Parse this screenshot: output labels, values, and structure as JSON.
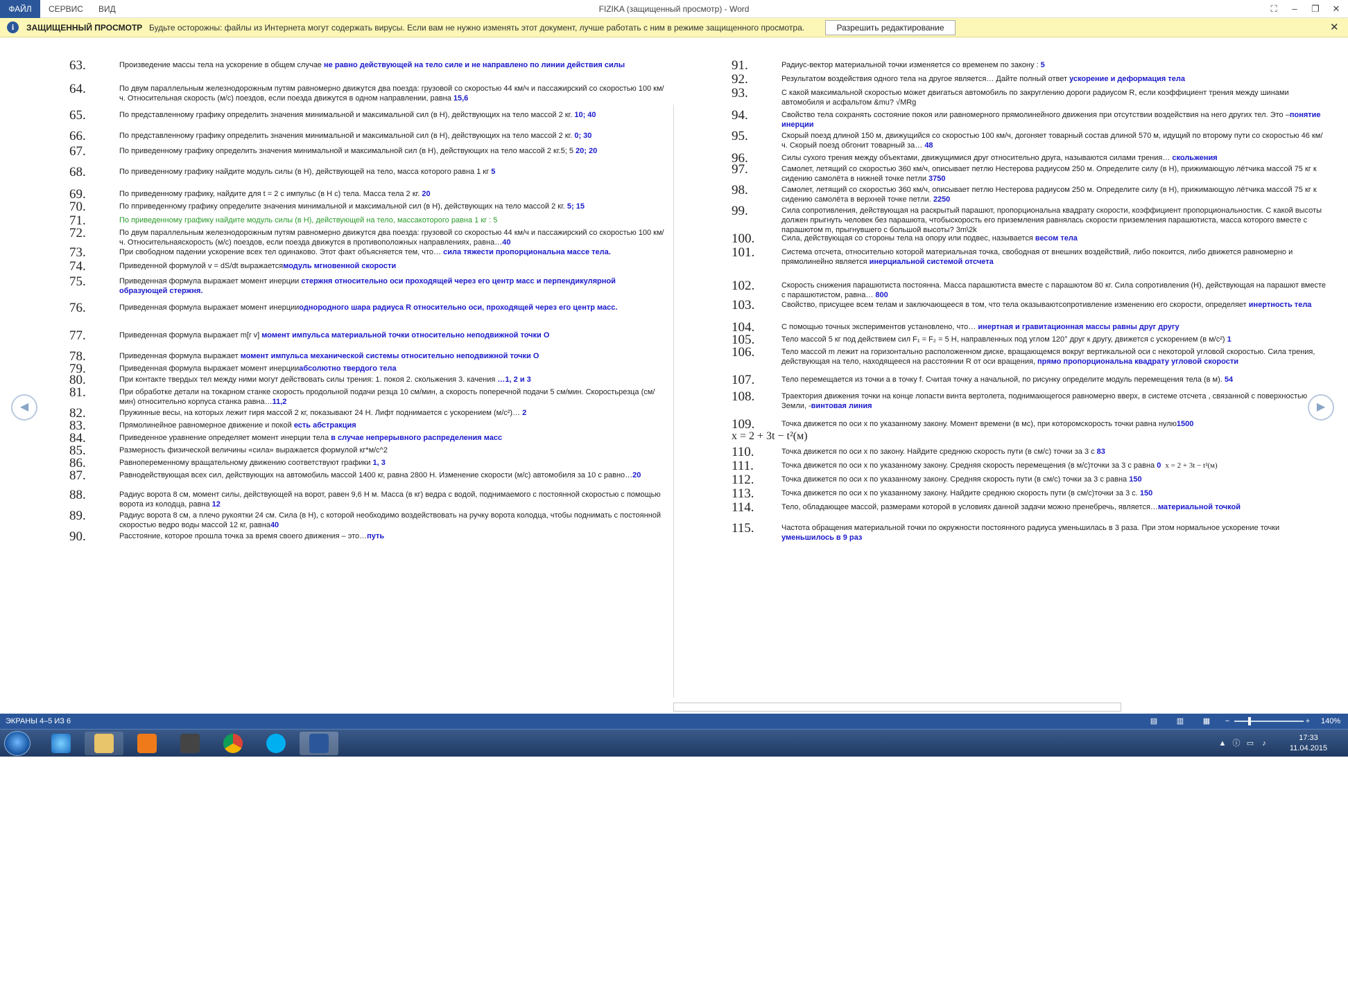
{
  "ribbon": {
    "file_tab": "ФАЙЛ",
    "tabs": [
      "СЕРВИС",
      "ВИД"
    ],
    "title": "FIZIKA (защищенный просмотр) - Word"
  },
  "protected_bar": {
    "title": "ЗАЩИЩЕННЫЙ ПРОСМОТР",
    "message": "Будьте осторожны: файлы из Интернета могут содержать вирусы. Если вам не нужно изменять этот документ, лучше работать с ним в режиме защищенного просмотра.",
    "button": "Разрешить редактирование"
  },
  "left_items": [
    {
      "n": "63.",
      "t": "Произведение массы тела на ускорение в общем случае ",
      "a": "не равно действующей на тело силе и не направлено по линии действия силы"
    },
    {
      "n": "64.",
      "t": "По двум параллельным железнодорожным путям равномерно движутся два поезда: грузовой со скоростью 44 км/ч и пассажирский со скоростью 100 км/ч. Относительная скорость (м/с) поездов, если поезда движутся в одном направлении, равна ",
      "a": "15,6"
    },
    {
      "n": "65.",
      "t": "По представленному графику определить значения минимальной и максимальной сил (в Н), действующих на тело массой 2 кг. ",
      "a": "10; 40"
    },
    {
      "n": "66.",
      "t": "По представленному графику определить значения минимальной и максимальной сил (в Н), действующих на тело массой 2 кг. ",
      "a": "0; 30"
    },
    {
      "n": "67.",
      "t": "По приведенному графику определить значения минимальной и максимальной сил (в Н), действующих на тело массой 2 кг.5; 5 ",
      "a": "20; 20"
    },
    {
      "n": "68.",
      "t": "По приведенному графику найдите модуль силы (в Н), действующей на тело, масса которого равна 1 кг ",
      "a": "5"
    },
    {
      "n": "69.",
      "t": "По приведенному графику, найдите для t = 2 с импульс (в Н с) тела. Масса тела 2 кг. ",
      "a": "20"
    },
    {
      "n": "70.",
      "t": "По пприведенному графику определите значения минимальной и максимальной сил (в Н), действующих на тело массой 2 кг. ",
      "a": "5; 15"
    },
    {
      "n": "71.",
      "t": "По приведенному графику найдите модуль силы (в Н), действующей на тело, массакоторого равна 1 кг : 5",
      "a": "",
      "green": true
    },
    {
      "n": "72.",
      "t": "По двум параллельным железнодорожным путям равномерно движутся два поезда: грузовой со скоростью 44 км/ч и пассажирский со скоростью 100 км/ч. Относительнаяскорость (м/с) поездов, если поезда движутся в противоположных направлениях, равна…",
      "a": "40"
    },
    {
      "n": "73.",
      "t": "При свободном падении ускорение всех тел одинаково. Этот факт объясняется тем, что… ",
      "a": "сила тяжести пропорциональна массе тела."
    },
    {
      "n": "74.",
      "t": "Приведенной формулой v = dS/dt выражается",
      "a": "модуль мгновенной скорости"
    },
    {
      "n": "75.",
      "t": "Приведенная формула выражает момент инерции ",
      "a": "стержня относительно оси проходящей через его центр масс и перпендикулярной образующей стержня."
    },
    {
      "n": "76.",
      "t": "Приведенная формула выражает момент инерции",
      "a": "однородного шара радиуса R относительно оси, проходящей через его центр масс."
    },
    {
      "n": "77.",
      "t": "Приведенная формула выражает m[r v] ",
      "a": "момент импульса материальной точки относительно неподвижной точки О"
    },
    {
      "n": "78.",
      "t": "Приведенная формула выражает ",
      "a": "момент импульса механической системы относительно неподвижной точки О"
    },
    {
      "n": "79.",
      "t": "Приведенная формула выражает момент инерции",
      "a": "абсолютно твердого тела"
    },
    {
      "n": "80.",
      "t": "При контакте твердых тел между ними могут действовать силы трения: 1. покоя 2. скольжения 3. качения ",
      "a": "…1, 2 и 3"
    },
    {
      "n": "81.",
      "t": "При обработке детали на токарном станке скорость продольной подачи резца 10 см/мин, а скорость поперечной подачи 5 см/мин. Скоростьрезца (см/мин) относительно корпуса станка равна…",
      "a": "11,2"
    },
    {
      "n": "82.",
      "t": "Пружинные весы, на которых лежит гиря массой 2 кг, показывают 24 Н. Лифт поднимается с ускорением (м/с²)… ",
      "a": "2"
    },
    {
      "n": "83.",
      "t": "Прямолинейное равномерное движение и покой ",
      "a": "есть абстракция"
    },
    {
      "n": "84.",
      "t": "Приведенное уравнение определяет момент инерции тела ",
      "a": "в случае непрерывного распределения масс"
    },
    {
      "n": "85.",
      "t": "Размерность физической величины «сила» выражается формулой кг*м/с^2",
      "a": ""
    },
    {
      "n": "86.",
      "t": "Равнопеременному вращательному движению соответствуют графики ",
      "a": "1, 3"
    },
    {
      "n": "87.",
      "t": "Равнодействующая всех сил, действующих на автомобиль массой 1400 кг, равна 2800 Н. Изменение скорости (м/с) автомобиля за 10 с равно…",
      "a": "20"
    },
    {
      "n": "88.",
      "t": "Радиус ворота 8 см, момент силы, действующей на ворот, равен 9,6 Н м. Масса (в кг) ведра с водой, поднимаемого с постоянной скоростью с помощью ворота из колодца, равна ",
      "a": "12"
    },
    {
      "n": "89.",
      "t": "Радиус ворота 8 см, а плечо рукоятки 24 см. Сила (в Н), с которой необходимо воздействовать на ручку ворота колодца, чтобы поднимать с постоянной скоростью ведро воды массой 12 кг, равна",
      "a": "40"
    },
    {
      "n": "90.",
      "t": "Расстояние, которое прошла точка за время своего движения – это…",
      "a": "путь"
    }
  ],
  "right_items": [
    {
      "n": "91.",
      "t": "Радиус-вектор материальной точки изменяется со временем по закону : ",
      "a": "5"
    },
    {
      "n": "92.",
      "t": "Результатом воздействия одного тела на другое является… Дайте полный ответ ",
      "a": "ускорение и деформация тела"
    },
    {
      "n": "93.",
      "t": "С какой максимальной скоростью может двигаться автомобиль по закруглению дороги радиусом R, если коэффициент трения между шинами автомобиля и асфальтом &mu? √MRg",
      "a": ""
    },
    {
      "n": "94.",
      "t": "Свойство тела сохранять состояние покоя или равномерного прямолинейного движения при отсутствии воздействия на него других тел. Это –",
      "a": "понятие инерции"
    },
    {
      "n": "95.",
      "t": "Скорый поезд длиной 150 м, движущийся со скоростью 100 км/ч, догоняет товарный состав длиной 570 м, идущий по второму пути со скоростью 46 км/ч. Скорый поезд обгонит товарный за… ",
      "a": "48"
    },
    {
      "n": "96.",
      "t": "Силы сухого трения между объектами, движущимися друг относительно друга, называются силами трения… ",
      "a": "скольжения"
    },
    {
      "n": "97.",
      "t": "Самолет, летящий со скоростью 360 км/ч, описывает петлю Нестерова радиусом 250 м. Определите силу (в Н), прижимающую лётчика массой 75 кг к сидению самолёта в нижней точке петли ",
      "a": "3750"
    },
    {
      "n": "98.",
      "t": "Самолет, летящий со скоростью 360 км/ч, описывает петлю Нестерова радиусом 250 м. Определите силу (в Н), прижимающую лётчика массой 75 кг к сидению самолёта в верхней точке петли. ",
      "a": "2250"
    },
    {
      "n": "99.",
      "t": "Сила сопротивления, действующая на раскрытый парашют, пропорциональна квадрату скорости, коэффициент пропорциональностик. С какой высоты должен прыгнуть человек без парашюта, чтобыскорость его приземления равнялась скорости приземления парашютиста, масса которого вместе с парашютом m, прыгнувшего с большой высоты? 3m\\2k",
      "a": ""
    },
    {
      "n": "100.",
      "t": "Сила, действующая со стороны тела на опору или подвес, называется ",
      "a": "весом тела"
    },
    {
      "n": "101.",
      "t": "Система отсчета, относительно которой материальная точка, свободная от внешних воздействий, либо покоится, либо движется равномерно и прямолинейно является ",
      "a": "инерциальной системой отсчета"
    },
    {
      "n": "102.",
      "t": "Скорость снижения парашютиста постоянна. Масса парашютиста вместе с парашютом 80 кг. Сила сопротивления (Н), действующая на парашют вместе с парашютистом, равна… ",
      "a": "800"
    },
    {
      "n": "103.",
      "t": "Свойство, присущее всем телам и заключающееся в том, что тела оказываютсопротивление изменению его скорости, определяет ",
      "a": "инертность тела"
    },
    {
      "n": "104.",
      "t": "С помощью точных экспериментов установлено, что… ",
      "a": "инертная и гравитационная массы равны друг другу"
    },
    {
      "n": "105.",
      "t": "Тело массой 5 кг под действием сил F₁ = F₂ = 5 Н, направленных под углом 120° друг к другу, движется с ускорением (в м/с²) ",
      "a": "1"
    },
    {
      "n": "106.",
      "t": "Тело массой m лежит на горизонтально расположенном диске, вращающемся вокруг вертикальной оси с некоторой угловой скоростью. Сила трения, действующая на тело, находящееся на расстоянии R от оси вращения, ",
      "a": "прямо пропорциональна квадрату угловой скорости"
    },
    {
      "n": "107.",
      "t": "Тело перемещается из точки а в точку f. Считая точку а начальной, по рисунку определите модуль перемещения тела (в м). ",
      "a": "54"
    },
    {
      "n": "108.",
      "t": "Траектория движения точки на конце лопасти винта вертолета, поднимающегося равномерно вверх, в системе отсчета , связанной с поверхностью Земли, -",
      "a": "винтовая линия"
    },
    {
      "n": "109.",
      "t": "Точка движется по оси х по указанному закону. Момент времени (в мс), при которомскорость точки равна нулю",
      "a": "1500",
      "formula": "x = 2 + 3t − t²(м)"
    },
    {
      "n": "110.",
      "t": "Точка движется по оси х по закону. Найдите среднюю скорость пути (в см/с) точки за 3 с ",
      "a": "83"
    },
    {
      "n": "111.",
      "t": "Точка движется по оси х по указанному закону. Средняя скорость перемещения (в м/с)точки за 3 с равна ",
      "a": "0",
      "formula2": "x = 2 + 3t − t²(м)"
    },
    {
      "n": "112.",
      "t": "Точка движется по оси х по указанному закону. Средняя скорость пути (в см/с) точки за 3 с равна ",
      "a": "150"
    },
    {
      "n": "113.",
      "t": "Точка движется по оси х по указанному закону. Найдите среднюю скорость пути (в см/с)точки за 3 с. ",
      "a": "150"
    },
    {
      "n": "114.",
      "t": "Тело, обладающее массой, размерами которой в условиях данной задачи можно пренебречь, является…",
      "a": "материальной точкой"
    },
    {
      "n": "115.",
      "t": "Частота обращения материальной точки по окружности постоянного радиуса уменьшилась в 3 раза. При этом нормальное ускорение точки ",
      "a": "уменьшилось в 9 раз"
    }
  ],
  "status": {
    "pages": "ЭКРАНЫ 4–5 ИЗ 6",
    "zoom": "140%",
    "zoom_level_percent": 140
  },
  "taskbar": {
    "time": "17:33",
    "date": "11.04.2015"
  },
  "colors": {
    "word_blue": "#2b579a",
    "answer_blue": "#1a1acc",
    "message_bar": "#fcf7b6"
  }
}
